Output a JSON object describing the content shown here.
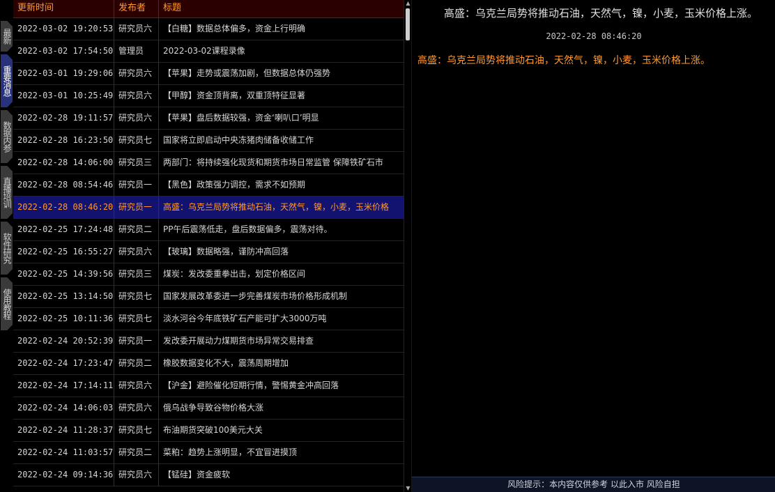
{
  "sidebar": {
    "tabs": [
      {
        "label": "最新",
        "active": false
      },
      {
        "label": "重要消息",
        "active": true
      },
      {
        "label": "数据内参",
        "active": false
      },
      {
        "label": "直播培训",
        "active": false
      },
      {
        "label": "软件研究",
        "active": false
      },
      {
        "label": "使用教程",
        "active": false
      }
    ]
  },
  "list": {
    "headers": {
      "time": "更新时间",
      "author": "发布者",
      "title": "标题"
    },
    "rows": [
      {
        "time": "2022-03-02 19:20:53",
        "author": "研究员六",
        "title": "【白糖】数据总体偏多，资金上行明确"
      },
      {
        "time": "2022-03-02 17:54:50",
        "author": "管理员",
        "title": "2022-03-02课程录像"
      },
      {
        "time": "2022-03-01 19:29:06",
        "author": "研究员六",
        "title": "【苹果】走势或震荡加剧，但数据总体仍强势"
      },
      {
        "time": "2022-03-01 10:25:49",
        "author": "研究员六",
        "title": "【甲醇】资金顶背离，双重顶特征显著"
      },
      {
        "time": "2022-02-28 19:11:57",
        "author": "研究员六",
        "title": "【苹果】盘后数据较强，资金‘喇叭口’明显"
      },
      {
        "time": "2022-02-28 16:23:50",
        "author": "研究员七",
        "title": "国家将立即启动中央冻猪肉储备收储工作"
      },
      {
        "time": "2022-02-28 14:06:00",
        "author": "研究员三",
        "title": "两部门：将持续强化现货和期货市场日常监管 保障铁矿石市"
      },
      {
        "time": "2022-02-28 08:54:46",
        "author": "研究员一",
        "title": "【黑色】政策强力调控，需求不如预期"
      },
      {
        "time": "2022-02-28 08:46:20",
        "author": "研究员一",
        "title": "高盛：乌克兰局势将推动石油，天然气，镍，小麦，玉米价格",
        "selected": true
      },
      {
        "time": "2022-02-25 17:24:48",
        "author": "研究员二",
        "title": "PP午后震荡低走，盘后数据偏多，震荡对待。"
      },
      {
        "time": "2022-02-25 16:55:27",
        "author": "研究员六",
        "title": "【玻璃】数据略强，谨防冲高回落"
      },
      {
        "time": "2022-02-25 14:39:56",
        "author": "研究员三",
        "title": "煤炭：发改委重拳出击，划定价格区间"
      },
      {
        "time": "2022-02-25 13:14:50",
        "author": "研究员七",
        "title": "国家发展改革委进一步完善煤炭市场价格形成机制"
      },
      {
        "time": "2022-02-25 10:11:36",
        "author": "研究员七",
        "title": "淡水河谷今年底铁矿石产能可扩大3000万吨"
      },
      {
        "time": "2022-02-24 20:52:39",
        "author": "研究员一",
        "title": "发改委开展动力煤期货市场异常交易排查"
      },
      {
        "time": "2022-02-24 17:23:47",
        "author": "研究员二",
        "title": "橡胶数据变化不大，震荡周期增加"
      },
      {
        "time": "2022-02-24 17:14:11",
        "author": "研究员六",
        "title": "【沪金】避险催化短期行情，警惕黄金冲高回落"
      },
      {
        "time": "2022-02-24 14:06:03",
        "author": "研究员六",
        "title": "俄乌战争导致谷物价格大涨"
      },
      {
        "time": "2022-02-24 11:28:37",
        "author": "研究员七",
        "title": "布油期货突破100美元大关"
      },
      {
        "time": "2022-02-24 11:03:57",
        "author": "研究员二",
        "title": "菜粕：趋势上涨明显，不宜冒进摸顶"
      },
      {
        "time": "2022-02-24 09:14:36",
        "author": "研究员六",
        "title": "【锰硅】资金疲软"
      }
    ]
  },
  "detail": {
    "title": "高盛：乌克兰局势将推动石油，天然气，镍，小麦，玉米价格上涨。",
    "time": "2022-02-28 08:46:20",
    "body": "高盛：乌克兰局势将推动石油，天然气，镍，小麦，玉米价格上涨。"
  },
  "footer": {
    "text": "风险提示：本内容仅供参考 以此入市 风险自担"
  },
  "icons": {
    "scroll_up": "triangle-up",
    "scroll_down": "triangle-down"
  },
  "colors": {
    "accent": "#ff9a2e",
    "border": "#a80000",
    "selected_row": "#121270",
    "active_tab": "#27327a"
  }
}
